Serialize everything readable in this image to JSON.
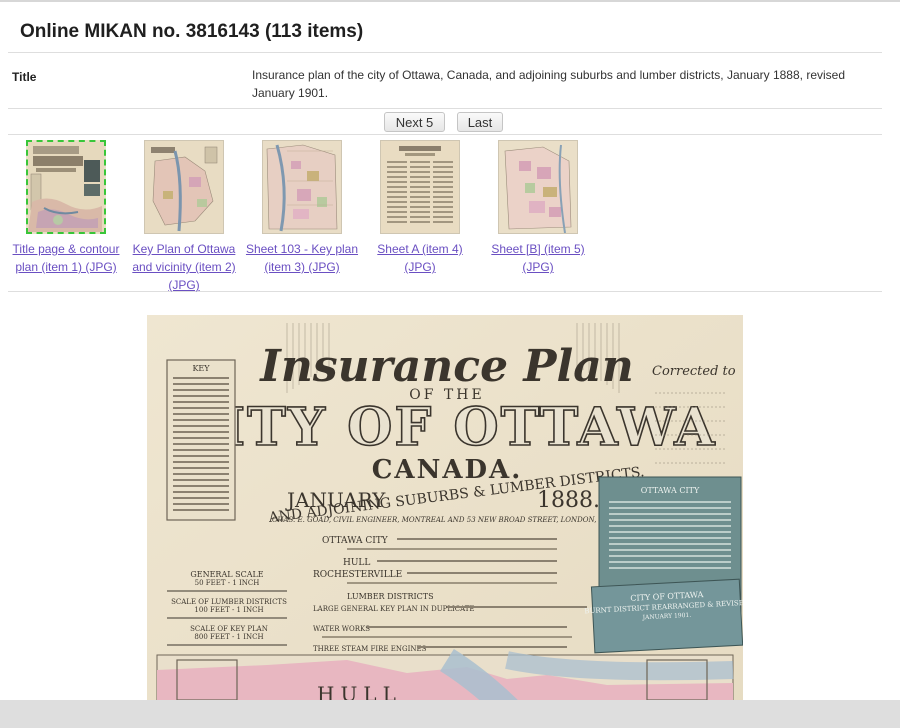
{
  "page": {
    "title": "Online MIKAN no. 3816143 (113 items)"
  },
  "record": {
    "field_label": "Title",
    "field_value": "Insurance plan of the city of Ottawa, Canada, and adjoining suburbs and lumber districts, January 1888, revised January 1901."
  },
  "pager": {
    "next_label": "Next 5",
    "last_label": "Last"
  },
  "thumbnails": [
    {
      "caption": "Title page & contour plan (item 1) (JPG)"
    },
    {
      "caption": "Key Plan of Ottawa and vicinity (item 2) (JPG)"
    },
    {
      "caption": "Sheet 103 - Key plan (item 3) (JPG)"
    },
    {
      "caption": "Sheet A (item 4) (JPG)"
    },
    {
      "caption": "Sheet [B] (item 5) (JPG)"
    }
  ],
  "map": {
    "headline": "Insurance Plan",
    "of_the": "OF THE",
    "city": "CITY OF OTTAWA",
    "country": "CANADA.",
    "subtitle": "AND ADJOINING SUBURBS & LUMBER DISTRICTS.",
    "date_month": "JANUARY",
    "date_year": "1888.",
    "publisher": "CHAS. E. GOAD, CIVIL ENGINEER, MONTREAL AND 53 NEW BROAD STREET, LONDON, E.C. ENG.",
    "corrected_to": "Corrected to",
    "key_label": "KEY",
    "general_scale": "GENERAL SCALE",
    "general_scale_value": "50 FEET - 1 INCH",
    "lumber_scale": "SCALE OF LUMBER DISTRICTS",
    "lumber_scale_value": "100 FEET - 1 INCH",
    "keyplan_scale": "SCALE OF KEY PLAN",
    "keyplan_scale_value": "800 FEET - 1 INCH",
    "line_ottawa": "OTTAWA CITY",
    "line_hull": "HULL",
    "line_rochesterville": "ROCHESTERVILLE",
    "line_lumber": "LUMBER DISTRICTS",
    "line_general_key": "LARGE GENERAL KEY PLAN IN DUPLICATE",
    "line_waterworks": "WATER WORKS",
    "line_fire_engines": "THREE STEAM FIRE ENGINES",
    "panel1_title": "OTTAWA CITY",
    "panel2_title": "CITY OF OTTAWA",
    "panel2_sub": "BURNT DISTRICT REARRANGED & REVISED",
    "panel2_date": "JANUARY 1901.",
    "hull_label": "HULL"
  }
}
